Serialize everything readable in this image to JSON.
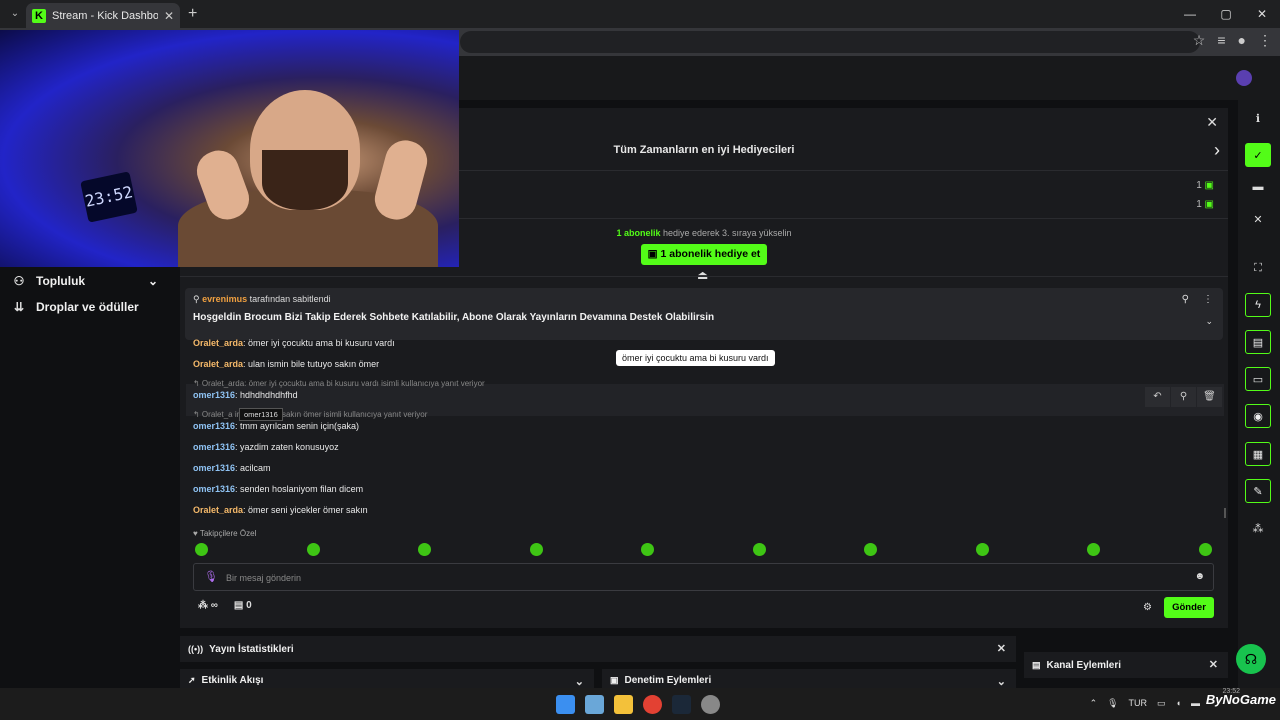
{
  "browser": {
    "tab_title": "Stream - Kick Dashboard",
    "new_tab": "+",
    "win_min": "—",
    "win_max": "▢",
    "win_close": "✕"
  },
  "webcam": {
    "clock_text": "23:52"
  },
  "sidebar": {
    "items": [
      {
        "label": "Topluluk",
        "icon": "users-icon"
      },
      {
        "label": "Droplar ve ödüller",
        "icon": "drops-icon"
      }
    ]
  },
  "leaderboard": {
    "title": "Tüm Zamanların en iyi Hediyecileri",
    "counts": [
      "1",
      "1"
    ],
    "hint_highlight": "1 abonelik",
    "hint_rest": " hediye ederek 3. sıraya yükselin",
    "gift_button": "1 abonelik hediye et"
  },
  "pinned": {
    "user": "evrenimus",
    "by_text": " tarafından sabitlendi",
    "message": "Hoşgeldin Brocum Bizi Takip Ederek Sohbete Katılabilir, Abone Olarak Yayınların Devamına Destek Olabilirsin"
  },
  "chat": {
    "messages": [
      {
        "user": "Oralet_arda",
        "text": ": ömer iyi çocuktu ama bi kusuru vardı",
        "color": "orange"
      },
      {
        "user": "Oralet_arda",
        "text": ": ulan ismin bile tutuyo sakın ömer",
        "color": "orange"
      },
      {
        "user": "omer1316",
        "text": ": hdhdhdhdhfhd",
        "color": "blue"
      },
      {
        "user": "omer1316",
        "text": ": tmm ayrılcam senin için(şaka)",
        "color": "blue"
      },
      {
        "user": "omer1316",
        "text": ": yazdim zaten konusuyoz",
        "color": "blue"
      },
      {
        "user": "omer1316",
        "text": ": acilcam",
        "color": "blue"
      },
      {
        "user": "omer1316",
        "text": ": senden hoslaniyom filan dicem",
        "color": "blue"
      },
      {
        "user": "Oralet_arda",
        "text": ": ömer seni yicekler ömer sakın",
        "color": "orange"
      }
    ],
    "reply1": "↰ Oralet_arda: ömer iyi çocuktu ama bi kusuru vardı isimli kullanıcıya yanıt veriyor",
    "reply2": "↰ Oralet_a        in bile tutuyo sakın ömer isimli kullanıcıya yanıt veriyor",
    "tooltip": "ömer iyi çocuktu ama bi kusuru vardı",
    "user_tooltip": "omer1316",
    "followers_only": "♥ Takipçilere Özel",
    "input_placeholder": "Bir mesaj gönderin",
    "infinity": "∞",
    "gift_count": "0",
    "send": "Gönder"
  },
  "panels": {
    "stats": "Yayın İstatistikleri",
    "activity": "Etkinlik Akışı",
    "moderation": "Denetim Eylemleri",
    "channel": "Kanal Eylemleri"
  },
  "taskbar": {
    "lang": "TUR",
    "time": "23:52",
    "watermark": "ByNoGame"
  },
  "colors": {
    "accent": "#53fc18",
    "orange_user": "#f5b96a",
    "blue_user": "#8fc3f4"
  }
}
